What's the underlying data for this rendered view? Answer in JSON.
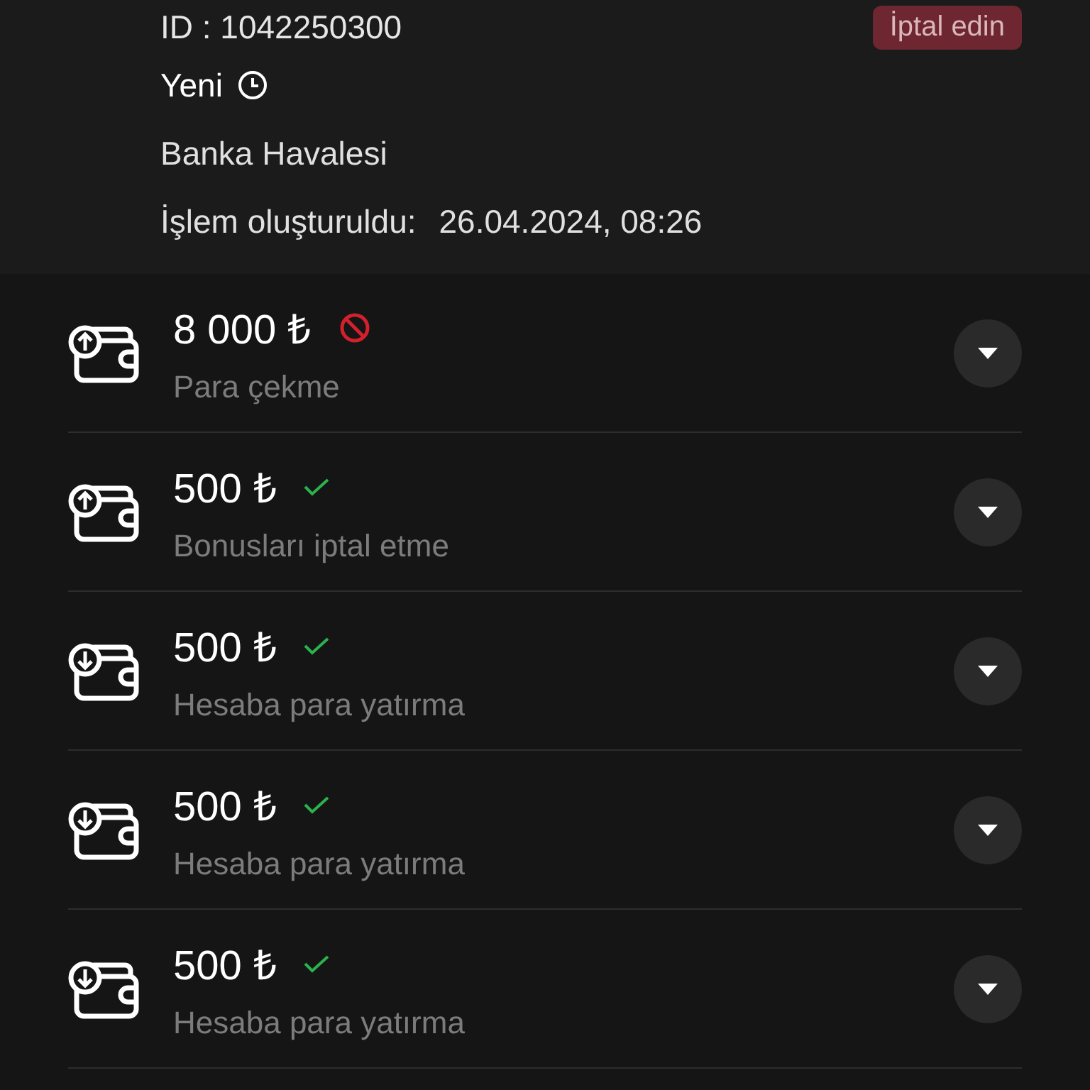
{
  "header": {
    "id_line": "ID : 1042250300",
    "cancel_button": "İptal edin",
    "status": "Yeni",
    "method": "Banka Havalesi",
    "created_label": "İşlem oluşturuldu:",
    "created_value": "26.04.2024, 08:26"
  },
  "transactions": [
    {
      "kind": "withdraw",
      "amount": "8 000 ₺",
      "rejected": true,
      "label": "Para çekme",
      "expanded": false
    },
    {
      "kind": "withdraw",
      "amount": "500 ₺",
      "rejected": false,
      "label": "Bonusları iptal etme",
      "expanded": false
    },
    {
      "kind": "deposit",
      "amount": "500 ₺",
      "rejected": false,
      "label": "Hesaba para yatırma",
      "expanded": false
    },
    {
      "kind": "deposit",
      "amount": "500 ₺",
      "rejected": false,
      "label": "Hesaba para yatırma",
      "expanded": false
    },
    {
      "kind": "deposit",
      "amount": "500 ₺",
      "rejected": false,
      "label": "Hesaba para yatırma",
      "expanded": false
    }
  ]
}
